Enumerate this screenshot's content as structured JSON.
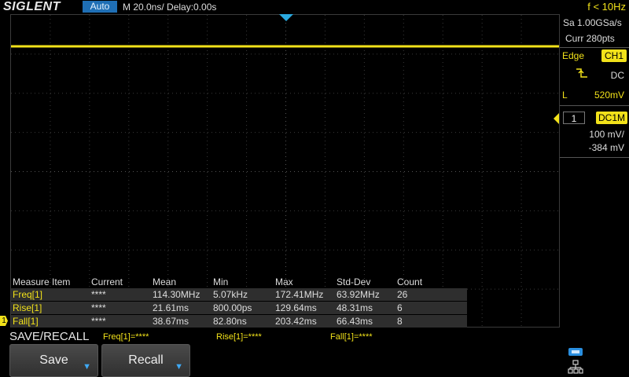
{
  "topbar": {
    "logo": "SIGLENT",
    "run_mode": "Auto",
    "timebase": "M 20.0ns/  Delay:0.00s",
    "trigger_freq": "f < 10Hz"
  },
  "acquisition": {
    "sample_rate": "Sa 1.00GSa/s",
    "curr_pts": "Curr 280pts"
  },
  "trigger": {
    "type": "Edge",
    "source": "CH1",
    "coupling": "DC",
    "level_label": "L",
    "level": "520mV",
    "slope_icon": "rising-edge-icon"
  },
  "channel": {
    "number": "1",
    "coupling": "DC1M",
    "scale": "100 mV/",
    "offset": "-384 mV",
    "color": "#f2e21a"
  },
  "measure": {
    "headers": [
      "Measure Item",
      "Current",
      "Mean",
      "Min",
      "Max",
      "Std-Dev",
      "Count"
    ],
    "rows": [
      [
        "Freq[1]",
        "****",
        "114.30MHz",
        "5.07kHz",
        "172.41MHz",
        "63.92MHz",
        "26"
      ],
      [
        "Rise[1]",
        "****",
        "21.61ms",
        "800.00ps",
        "129.64ms",
        "48.31ms",
        "6"
      ],
      [
        "Fall[1]",
        "****",
        "38.67ms",
        "82.80ns",
        "203.42ms",
        "66.43ms",
        "8"
      ]
    ]
  },
  "menu": {
    "title": "SAVE/RECALL",
    "status_freq": "Freq[1]=****",
    "status_rise": "Rise[1]=****",
    "status_fall": "Fall[1]=****",
    "save_label": "Save",
    "recall_label": "Recall"
  },
  "marker": {
    "ch1_label": "1"
  }
}
